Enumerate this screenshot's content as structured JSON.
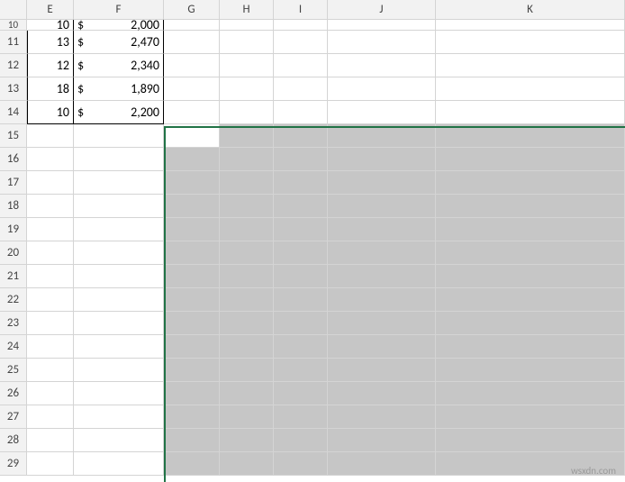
{
  "columns": [
    "E",
    "F",
    "G",
    "H",
    "I",
    "J",
    "K"
  ],
  "row_headers": [
    "10",
    "11",
    "12",
    "13",
    "14",
    "15",
    "16",
    "17",
    "18",
    "19",
    "20",
    "21",
    "22",
    "23",
    "24",
    "25",
    "26",
    "27",
    "28",
    "29"
  ],
  "data_rows": [
    {
      "col_e": "10",
      "currency": "$",
      "value": "2,000"
    },
    {
      "col_e": "13",
      "currency": "$",
      "value": "2,470"
    },
    {
      "col_e": "12",
      "currency": "$",
      "value": "2,340"
    },
    {
      "col_e": "18",
      "currency": "$",
      "value": "1,890"
    },
    {
      "col_e": "10",
      "currency": "$",
      "value": "2,200"
    }
  ],
  "watermark": "wsxdn.com"
}
